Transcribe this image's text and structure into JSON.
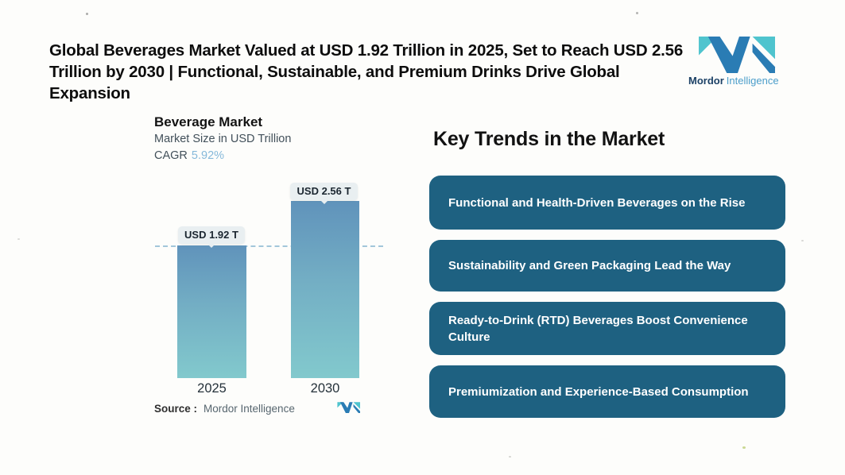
{
  "header": {
    "title_line1": "Global Beverages Market Valued at USD 1.92 Trillion in 2025, Set to Reach USD 2.56",
    "title_line2": "Trillion by 2030 | Functional, Sustainable, and Premium Drinks Drive Global Expansion"
  },
  "brand": {
    "name_bold": "Mordor",
    "name_light": "Intelligence"
  },
  "chart": {
    "title": "Beverage Market",
    "subtitle": "Market Size in USD Trillion",
    "cagr_label": "CAGR",
    "cagr_value": "5.92%",
    "bars": [
      {
        "year": "2025",
        "label": "USD 1.92 T",
        "value": 1.92
      },
      {
        "year": "2030",
        "label": "USD 2.56 T",
        "value": 2.56
      }
    ],
    "source_label": "Source :",
    "source_value": "Mordor Intelligence"
  },
  "trends": {
    "heading": "Key Trends in the Market",
    "items": [
      {
        "label": "Functional and Health-Driven Beverages on the Rise"
      },
      {
        "label": "Sustainability and Green Packaging Lead the Way"
      },
      {
        "label": "Ready-to-Drink (RTD) Beverages Boost Convenience Culture"
      },
      {
        "label": "Premiumization and Experience-Based Consumption"
      }
    ]
  },
  "colors": {
    "trend_pill_bg": "#1e6181",
    "bar_gradient_top": "#6093bb",
    "bar_gradient_bottom": "#82c9cd",
    "dashed_line": "#a2c6da",
    "value_pill_bg": "#e9eff1",
    "cagr_value_color": "#86b9da",
    "logo_teal": "#4fc4ce",
    "logo_blue": "#2a7cb4"
  },
  "chart_data": {
    "type": "bar",
    "title": "Beverage Market",
    "subtitle": "Market Size in USD Trillion",
    "unit": "USD Trillion",
    "categories": [
      "2025",
      "2030"
    ],
    "values": [
      1.92,
      2.56
    ],
    "data_labels": [
      "USD 1.92 T",
      "USD 2.56 T"
    ],
    "cagr_percent": 5.92,
    "ylim": [
      0,
      3
    ],
    "grid": false,
    "legend": false,
    "reference_line_y": 1.92
  }
}
